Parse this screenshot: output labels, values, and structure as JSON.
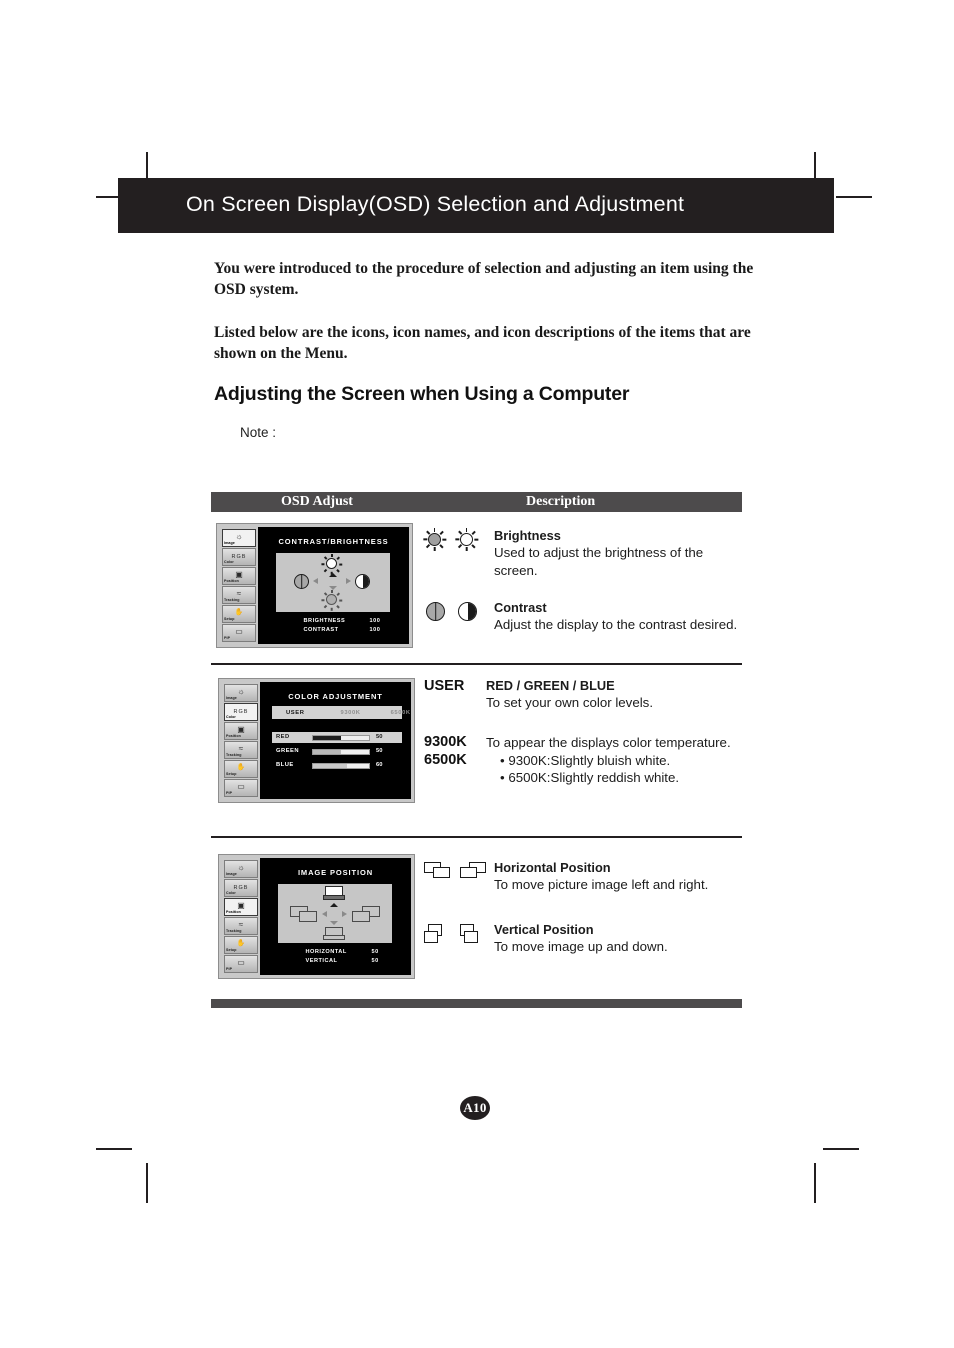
{
  "header": {
    "title": "On Screen Display(OSD) Selection and Adjustment"
  },
  "intro": {
    "paragraph_1": "You were introduced to the procedure of selection and adjusting an item using the OSD system.",
    "paragraph_2": "Listed below are the icons, icon names, and icon descriptions of the items that are shown on the Menu.",
    "section_heading": "Adjusting the Screen when Using a Computer",
    "note_label": "Note :"
  },
  "table": {
    "col_osd": "OSD Adjust",
    "col_description": "Description"
  },
  "osd_sidebar_tabs": [
    {
      "label": "Image",
      "glyph": "☼"
    },
    {
      "label": "Color",
      "glyph": "RGB"
    },
    {
      "label": "Position",
      "glyph": "▣"
    },
    {
      "label": "Tracking",
      "glyph": "≈"
    },
    {
      "label": "Setup",
      "glyph": "✋"
    },
    {
      "label": "PIP",
      "glyph": "▭"
    }
  ],
  "osd_screens": {
    "contrast_brightness": {
      "title": "CONTRAST/BRIGHTNESS",
      "selected_tab": "Image",
      "readouts": [
        {
          "key": "BRIGHTNESS",
          "value": "100"
        },
        {
          "key": "CONTRAST",
          "value": "100"
        }
      ]
    },
    "color_adjustment": {
      "title": "COLOR ADJUSTMENT",
      "selected_tab": "Color",
      "presets": [
        {
          "label": "USER",
          "active": true
        },
        {
          "label": "9300K",
          "active": false
        },
        {
          "label": "6500K",
          "active": false
        }
      ],
      "sliders": [
        {
          "label": "RED",
          "value": "50",
          "percent": 50,
          "fill_color": "#1f1f1f",
          "highlighted": true
        },
        {
          "label": "GREEN",
          "value": "50",
          "percent": 50,
          "fill_color": "#b9b9b9",
          "highlighted": false
        },
        {
          "label": "BLUE",
          "value": "60",
          "percent": 60,
          "fill_color": "#c9c9c9",
          "highlighted": false
        }
      ]
    },
    "image_position": {
      "title": "IMAGE POSITION",
      "selected_tab": "Position",
      "readouts": [
        {
          "key": "HORIZONTAL",
          "value": "50"
        },
        {
          "key": "VERTICAL",
          "value": "50"
        }
      ]
    }
  },
  "descriptions": {
    "brightness": {
      "title": "Brightness",
      "body": "Used to adjust the brightness of the screen."
    },
    "contrast": {
      "title": "Contrast",
      "body": "Adjust the display to the contrast desired."
    },
    "user": {
      "key": "USER",
      "title": "RED / GREEN / BLUE",
      "body": "To set your own color levels."
    },
    "temperature": {
      "key_line_1": "9300K",
      "key_line_2": "6500K",
      "body": "To appear the displays color temperature.",
      "bullet_1": "• 9300K:Slightly bluish white.",
      "bullet_2": "• 6500K:Slightly reddish white."
    },
    "horizontal_position": {
      "title": "Horizontal Position",
      "body": "To move picture image left and right."
    },
    "vertical_position": {
      "title": "Vertical Position",
      "body": "To move image up and down."
    }
  },
  "footer": {
    "page_number": "A10"
  },
  "colors": {
    "banner": "#231f20",
    "table_header": "#4d4b4c",
    "osd_bezel": "#c8c8c8",
    "osd_screen": "#000000"
  }
}
